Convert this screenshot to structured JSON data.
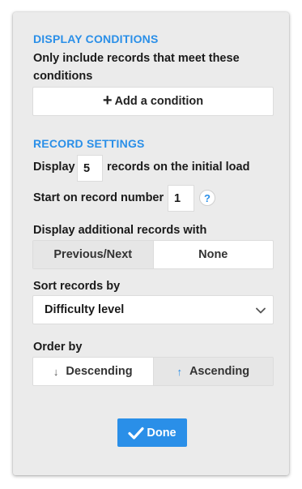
{
  "display_conditions": {
    "title": "DISPLAY CONDITIONS",
    "description": "Only include records that meet these conditions",
    "add_label": "Add a condition"
  },
  "record_settings": {
    "title": "RECORD SETTINGS",
    "display_prefix": "Display",
    "display_count": "5",
    "display_suffix": "records on the initial load",
    "start_label": "Start on record number",
    "start_value": "1",
    "help_label": "?",
    "additional_label": "Display additional records with",
    "additional_options": [
      "Previous/Next",
      "None"
    ],
    "additional_selected": "Previous/Next",
    "sort_label": "Sort records by",
    "sort_value": "Difficulty level",
    "order_label": "Order by",
    "order_options": [
      "Descending",
      "Ascending"
    ],
    "order_selected": "Ascending"
  },
  "done_label": "Done",
  "colors": {
    "accent": "#2a8fe8",
    "panel": "#ebebeb"
  },
  "icons": {
    "add": "plus-icon",
    "help": "help-icon",
    "sort_chevron": "chevron-down-icon",
    "descending": "arrow-down-icon",
    "ascending": "arrow-up-icon",
    "done": "check-icon"
  }
}
